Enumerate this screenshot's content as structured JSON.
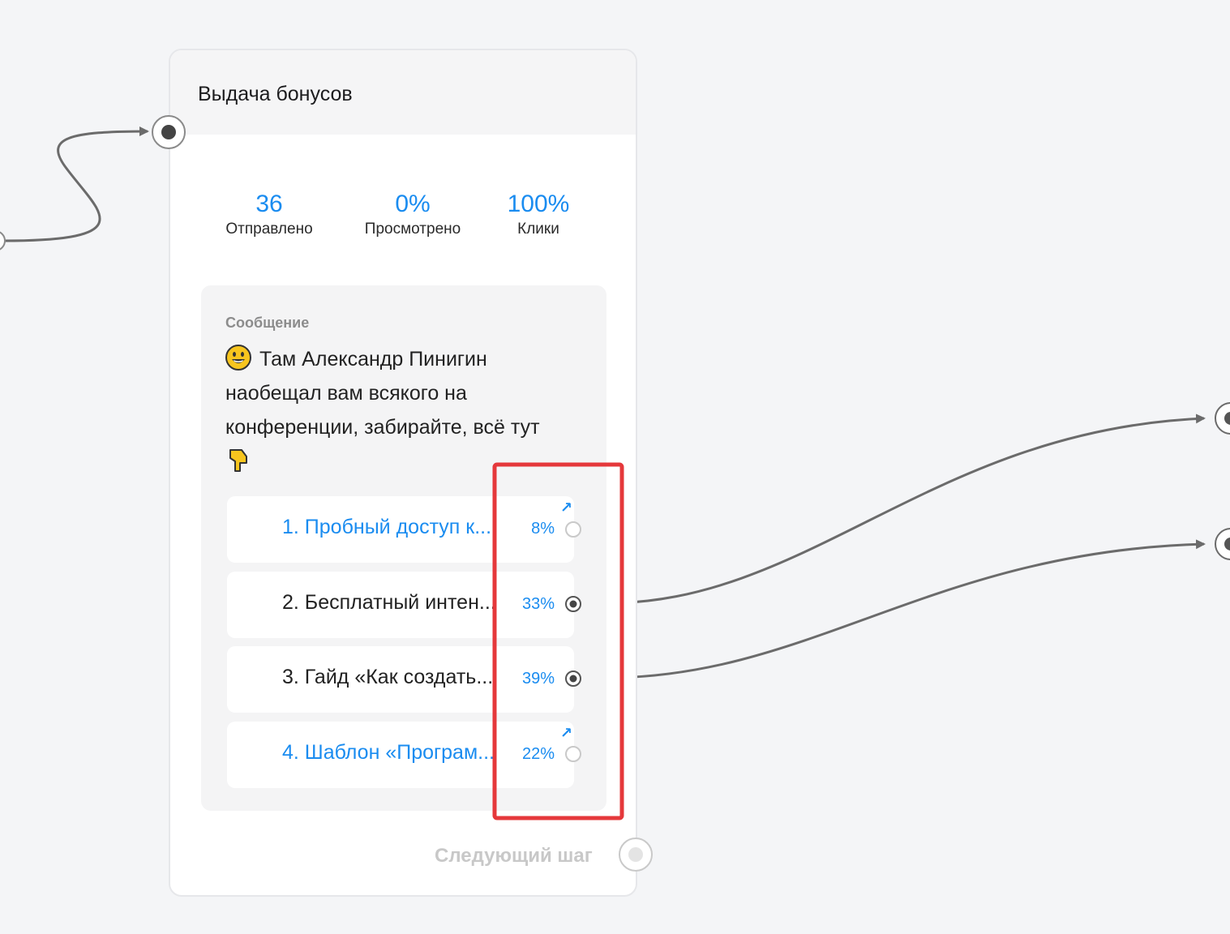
{
  "card": {
    "title": "Выдача бонусов",
    "stats": [
      {
        "value": "36",
        "label": "Отправлено"
      },
      {
        "value": "0%",
        "label": "Просмотрено"
      },
      {
        "value": "100%",
        "label": "Клики"
      }
    ],
    "message": {
      "caption": "Сообщение",
      "text": "Там Александр Пинигин наобещал вам всякого на конференции, забирайте, всё тут"
    },
    "buttons": [
      {
        "label": "1. Пробный доступ к...",
        "percent": "8%",
        "is_link": true
      },
      {
        "label": "2. Бесплатный интен...",
        "percent": "33%",
        "is_link": false
      },
      {
        "label": "3. Гайд «Как создать...",
        "percent": "39%",
        "is_link": false
      },
      {
        "label": "4. Шаблон «Програм...",
        "percent": "22%",
        "is_link": true
      }
    ],
    "next_step_label": "Следующий шаг"
  },
  "colors": {
    "accent": "#1a8cf0",
    "connector": "#6b6b6b",
    "highlight": "#e5383b"
  }
}
